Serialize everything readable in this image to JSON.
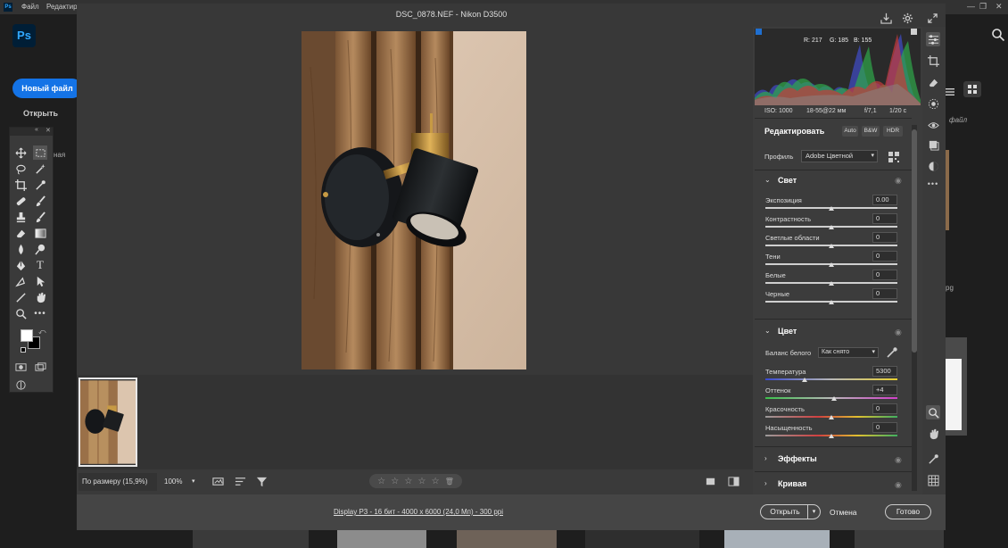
{
  "photoshop": {
    "logo_small": "Ps",
    "menu": [
      "Файл",
      "Редактир"
    ],
    "logo": "Ps",
    "new_file": "Новый файл",
    "open": "Открыть",
    "frag_tools": "ная",
    "frag_file": "файл",
    "frag_g": "pg"
  },
  "dialog": {
    "title": "DSC_0878.NEF  -  Nikon D3500",
    "zoom_fit": "По размеру (15,9%)",
    "zoom_percent": "100%",
    "stars": [
      "☆",
      "☆",
      "☆",
      "☆",
      "☆"
    ],
    "file_info": "Display P3 - 16 бит - 4000 x 6000 (24,0 Мп) - 300 ppi",
    "btn_open": "Открыть",
    "btn_cancel": "Отмена",
    "btn_done": "Готово"
  },
  "histogram": {
    "r": "R: 217",
    "g": "G: 185",
    "b": "B: 155",
    "iso": "ISO: 1000",
    "lens": "18-55@22 мм",
    "aperture": "f/7,1",
    "shutter": "1/20 с"
  },
  "edit": {
    "title": "Редактировать",
    "chip_auto": "Auto",
    "chip_bw": "B&W",
    "chip_hdr": "HDR",
    "profile_label": "Профиль",
    "profile_value": "Adobe Цветной"
  },
  "light": {
    "title": "Свет",
    "sliders": [
      {
        "label": "Экспозиция",
        "value": "0.00",
        "pos": 0.5
      },
      {
        "label": "Контрастность",
        "value": "0",
        "pos": 0.5
      },
      {
        "label": "Светлые области",
        "value": "0",
        "pos": 0.5
      },
      {
        "label": "Тени",
        "value": "0",
        "pos": 0.5
      },
      {
        "label": "Белые",
        "value": "0",
        "pos": 0.5
      },
      {
        "label": "Черные",
        "value": "0",
        "pos": 0.5
      }
    ]
  },
  "color": {
    "title": "Цвет",
    "wb_label": "Баланс белого",
    "wb_value": "Как снято",
    "sliders": [
      {
        "label": "Температура",
        "value": "5300",
        "pos": 0.3
      },
      {
        "label": "Оттенок",
        "value": "+4",
        "pos": 0.52
      },
      {
        "label": "Красочность",
        "value": "0",
        "pos": 0.5
      },
      {
        "label": "Насыщенность",
        "value": "0",
        "pos": 0.5
      }
    ]
  },
  "sections": {
    "effects": "Эффекты",
    "curve": "Кривая"
  }
}
